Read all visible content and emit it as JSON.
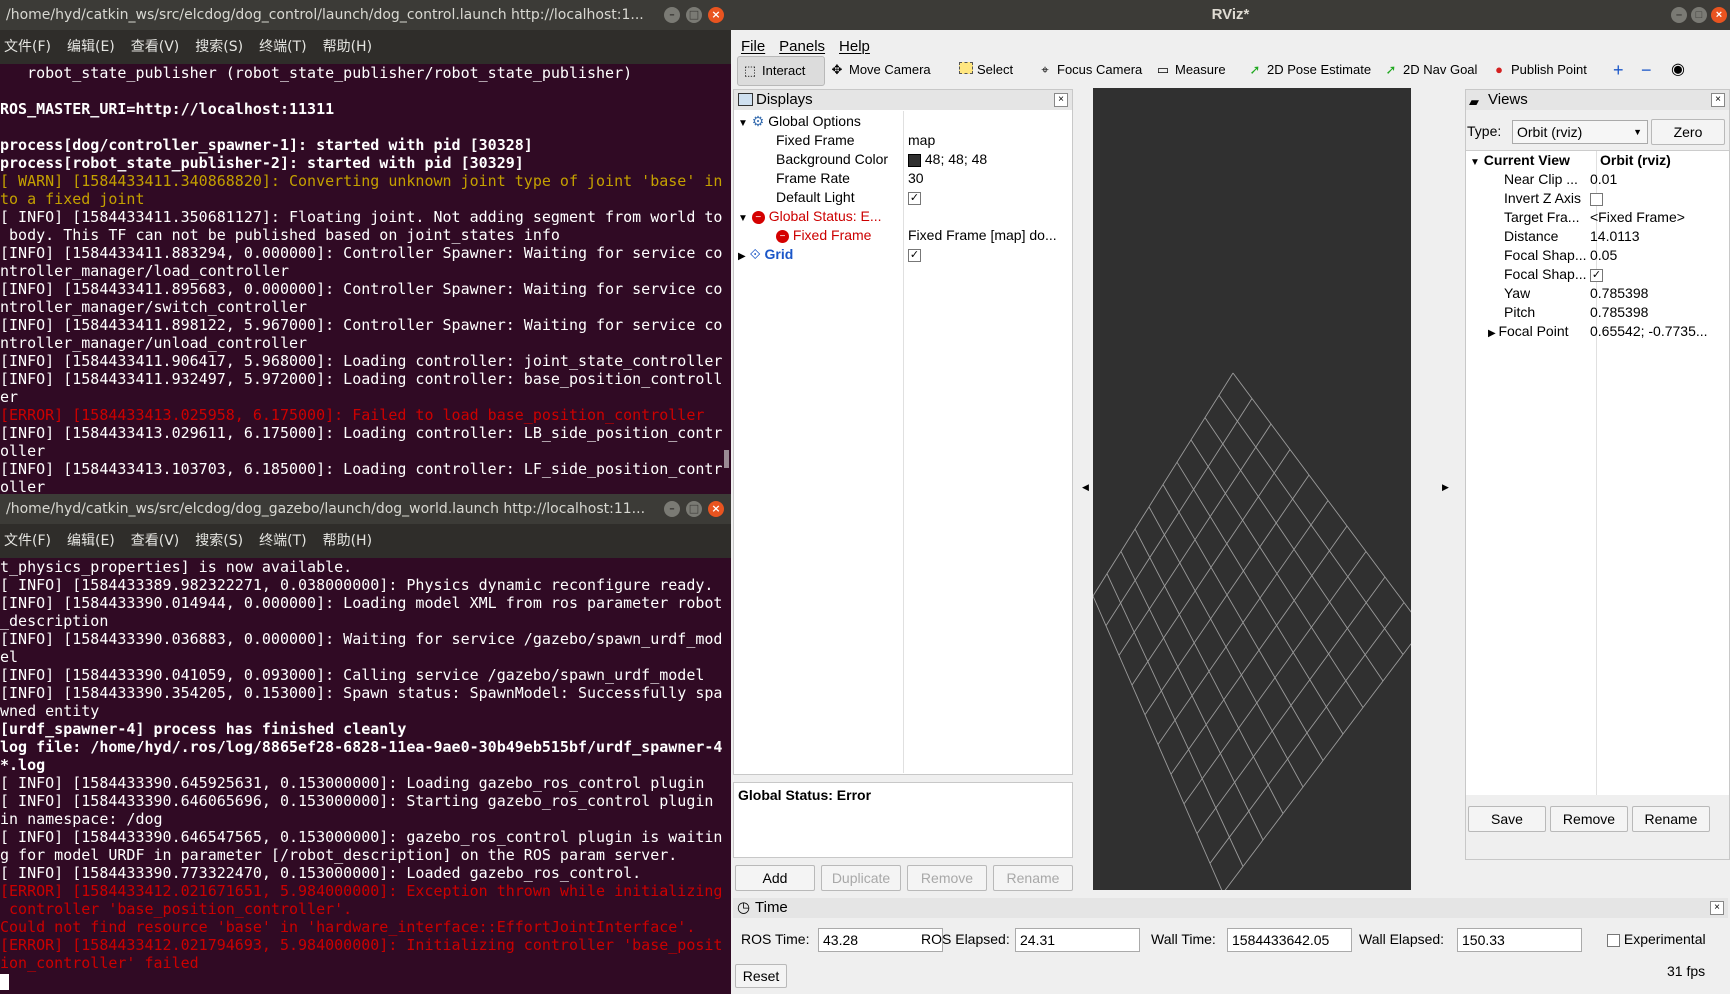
{
  "terminal1": {
    "title": "/home/hyd/catkin_ws/src/elcdog/dog_control/launch/dog_control.launch http://localhost:1...",
    "menu": [
      "文件(F)",
      "编辑(E)",
      "查看(V)",
      "搜索(S)",
      "终端(T)",
      "帮助(H)"
    ],
    "lines": [
      {
        "text": "   robot_state_publisher (robot_state_publisher/robot_state_publisher)",
        "style": ""
      },
      {
        "text": "",
        "style": ""
      },
      {
        "text": "ROS_MASTER_URI=http://localhost:11311",
        "style": "b"
      },
      {
        "text": "",
        "style": ""
      },
      {
        "text": "process[dog/controller_spawner-1]: started with pid [30328]",
        "style": "b"
      },
      {
        "text": "process[robot_state_publisher-2]: started with pid [30329]",
        "style": "b"
      },
      {
        "text": "[ WARN] [1584433411.340868820]: Converting unknown joint type of joint 'base' in",
        "style": "w"
      },
      {
        "text": "to a fixed joint",
        "style": "w"
      },
      {
        "text": "[ INFO] [1584433411.350681127]: Floating joint. Not adding segment from world to",
        "style": ""
      },
      {
        "text": " body. This TF can not be published based on joint_states info",
        "style": ""
      },
      {
        "text": "[INFO] [1584433411.883294, 0.000000]: Controller Spawner: Waiting for service co",
        "style": ""
      },
      {
        "text": "ntroller_manager/load_controller",
        "style": ""
      },
      {
        "text": "[INFO] [1584433411.895683, 0.000000]: Controller Spawner: Waiting for service co",
        "style": ""
      },
      {
        "text": "ntroller_manager/switch_controller",
        "style": ""
      },
      {
        "text": "[INFO] [1584433411.898122, 5.967000]: Controller Spawner: Waiting for service co",
        "style": ""
      },
      {
        "text": "ntroller_manager/unload_controller",
        "style": ""
      },
      {
        "text": "[INFO] [1584433411.906417, 5.968000]: Loading controller: joint_state_controller",
        "style": ""
      },
      {
        "text": "[INFO] [1584433411.932497, 5.972000]: Loading controller: base_position_controll",
        "style": ""
      },
      {
        "text": "er",
        "style": ""
      },
      {
        "text": "[ERROR] [1584433413.025958, 6.175000]: Failed to load base_position_controller",
        "style": "e"
      },
      {
        "text": "[INFO] [1584433413.029611, 6.175000]: Loading controller: LB_side_position_contr",
        "style": ""
      },
      {
        "text": "oller",
        "style": ""
      },
      {
        "text": "[INFO] [1584433413.103703, 6.185000]: Loading controller: LF_side_position_contr",
        "style": ""
      },
      {
        "text": "oller",
        "style": ""
      }
    ]
  },
  "terminal2": {
    "title": "/home/hyd/catkin_ws/src/elcdog/dog_gazebo/launch/dog_world.launch http://localhost:11...",
    "menu": [
      "文件(F)",
      "编辑(E)",
      "查看(V)",
      "搜索(S)",
      "终端(T)",
      "帮助(H)"
    ],
    "lines": [
      {
        "text": "t_physics_properties] is now available.",
        "style": ""
      },
      {
        "text": "[ INFO] [1584433389.982322271, 0.038000000]: Physics dynamic reconfigure ready.",
        "style": ""
      },
      {
        "text": "[INFO] [1584433390.014944, 0.000000]: Loading model XML from ros parameter robot",
        "style": ""
      },
      {
        "text": "_description",
        "style": ""
      },
      {
        "text": "[INFO] [1584433390.036883, 0.000000]: Waiting for service /gazebo/spawn_urdf_mod",
        "style": ""
      },
      {
        "text": "el",
        "style": ""
      },
      {
        "text": "[INFO] [1584433390.041059, 0.093000]: Calling service /gazebo/spawn_urdf_model",
        "style": ""
      },
      {
        "text": "[INFO] [1584433390.354205, 0.153000]: Spawn status: SpawnModel: Successfully spa",
        "style": ""
      },
      {
        "text": "wned entity",
        "style": ""
      },
      {
        "text": "[urdf_spawner-4] process has finished cleanly",
        "style": "b"
      },
      {
        "text": "log file: /home/hyd/.ros/log/8865ef28-6828-11ea-9ae0-30b49eb515bf/urdf_spawner-4",
        "style": "b"
      },
      {
        "text": "*.log",
        "style": "b"
      },
      {
        "text": "[ INFO] [1584433390.645925631, 0.153000000]: Loading gazebo_ros_control plugin",
        "style": ""
      },
      {
        "text": "[ INFO] [1584433390.646065696, 0.153000000]: Starting gazebo_ros_control plugin",
        "style": ""
      },
      {
        "text": "in namespace: /dog",
        "style": ""
      },
      {
        "text": "[ INFO] [1584433390.646547565, 0.153000000]: gazebo_ros_control plugin is waitin",
        "style": ""
      },
      {
        "text": "g for model URDF in parameter [/robot_description] on the ROS param server.",
        "style": ""
      },
      {
        "text": "[ INFO] [1584433390.773322470, 0.153000000]: Loaded gazebo_ros_control.",
        "style": ""
      },
      {
        "text": "[ERROR] [1584433412.021671651, 5.984000000]: Exception thrown while initializing",
        "style": "e"
      },
      {
        "text": " controller 'base_position_controller'.",
        "style": "e"
      },
      {
        "text": "Could not find resource 'base' in 'hardware_interface::EffortJointInterface'.",
        "style": "e"
      },
      {
        "text": "[ERROR] [1584433412.021794693, 5.984000000]: Initializing controller 'base_posit",
        "style": "e"
      },
      {
        "text": "ion_controller' failed",
        "style": "e"
      }
    ]
  },
  "rviz": {
    "title": "RViz*",
    "menu": {
      "file": "File",
      "panels": "Panels",
      "help": "Help"
    },
    "toolbar": {
      "interact": "Interact",
      "move_camera": "Move Camera",
      "select": "Select",
      "focus_camera": "Focus Camera",
      "measure": "Measure",
      "pose_estimate": "2D Pose Estimate",
      "nav_goal": "2D Nav Goal",
      "publish_point": "Publish Point"
    },
    "displays": {
      "header": "Displays",
      "global_options": "Global Options",
      "fixed_frame_label": "Fixed Frame",
      "fixed_frame_value": "map",
      "bg_color_label": "Background Color",
      "bg_color_value": "48; 48; 48",
      "bg_color_hex": "#303030",
      "frame_rate_label": "Frame Rate",
      "frame_rate_value": "30",
      "default_light_label": "Default Light",
      "global_status_label": "Global Status: E...",
      "fixed_frame_err_label": "Fixed Frame",
      "fixed_frame_err_value": "Fixed Frame [map] do...",
      "grid_label": "Grid",
      "status_text": "Global Status: Error",
      "add": "Add",
      "duplicate": "Duplicate",
      "remove": "Remove",
      "rename": "Rename"
    },
    "views": {
      "header": "Views",
      "type_label": "Type:",
      "type_value": "Orbit (rviz)",
      "zero": "Zero",
      "current_view": "Current View",
      "current_view_value": "Orbit (rviz)",
      "props": [
        {
          "label": "Near Clip ...",
          "value": "0.01"
        },
        {
          "label": "Invert Z Axis",
          "value": ""
        },
        {
          "label": "Target Fra...",
          "value": "<Fixed Frame>"
        },
        {
          "label": "Distance",
          "value": "14.0113"
        },
        {
          "label": "Focal Shap...",
          "value": "0.05"
        },
        {
          "label": "Focal Shap...",
          "value": "✓"
        },
        {
          "label": "Yaw",
          "value": "0.785398"
        },
        {
          "label": "Pitch",
          "value": "0.785398"
        },
        {
          "label": "Focal Point",
          "value": "0.65542; -0.7735..."
        }
      ],
      "save": "Save",
      "remove": "Remove",
      "rename": "Rename"
    },
    "time": {
      "header": "Time",
      "ros_time_label": "ROS Time:",
      "ros_time": "43.28",
      "ros_elapsed_label": "ROS Elapsed:",
      "ros_elapsed": "24.31",
      "wall_time_label": "Wall Time:",
      "wall_time": "1584433642.05",
      "wall_elapsed_label": "Wall Elapsed:",
      "wall_elapsed": "150.33",
      "experimental": "Experimental",
      "reset": "Reset",
      "fps": "31 fps"
    },
    "colors": {
      "error": "#cc0000",
      "grid_line": "#9a9a9a",
      "accent": "#1a56c8"
    }
  }
}
